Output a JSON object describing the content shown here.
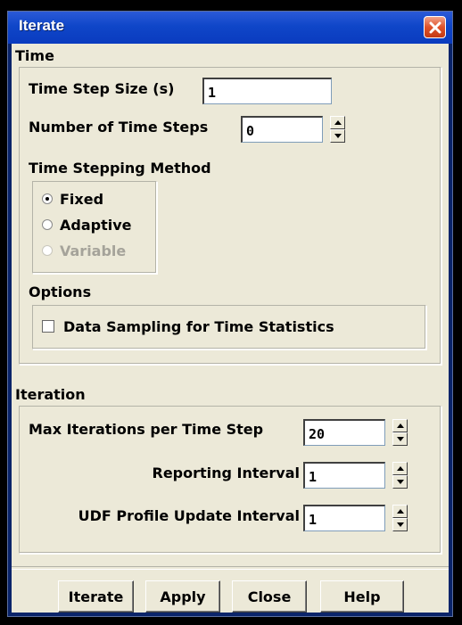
{
  "window": {
    "title": "Iterate"
  },
  "time": {
    "section_label": "Time",
    "step_size_label": "Time Step Size (s)",
    "step_size_value": "1",
    "num_steps_label": "Number of Time Steps",
    "num_steps_value": "0",
    "method_label": "Time Stepping Method",
    "methods": [
      {
        "label": "Fixed",
        "selected": true,
        "enabled": true
      },
      {
        "label": "Adaptive",
        "selected": false,
        "enabled": true
      },
      {
        "label": "Variable",
        "selected": false,
        "enabled": false
      }
    ],
    "options_label": "Options",
    "data_sampling_label": "Data Sampling for Time Statistics",
    "data_sampling_checked": false
  },
  "iteration": {
    "section_label": "Iteration",
    "max_iter_label": "Max Iterations per Time Step",
    "max_iter_value": "20",
    "reporting_label": "Reporting Interval",
    "reporting_value": "1",
    "udf_label": "UDF Profile Update Interval",
    "udf_value": "1"
  },
  "buttons": {
    "iterate": "Iterate",
    "apply": "Apply",
    "close": "Close",
    "help": "Help"
  }
}
